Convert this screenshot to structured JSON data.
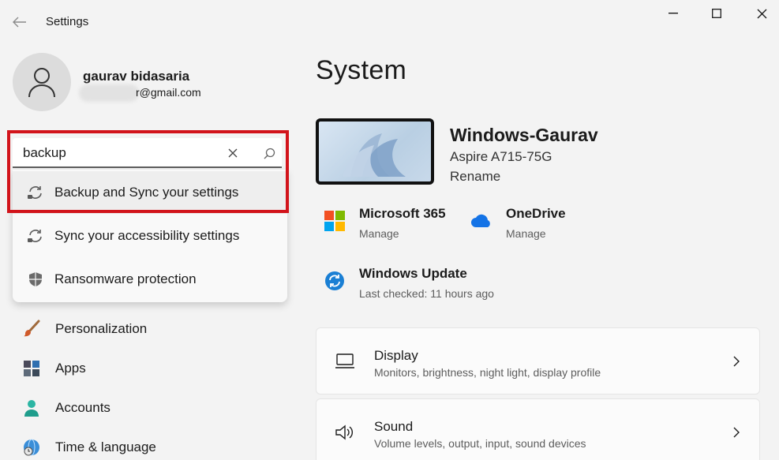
{
  "window": {
    "title": "Settings"
  },
  "profile": {
    "name": "gaurav bidasaria",
    "email_visible": "r@gmail.com"
  },
  "search": {
    "value": "backup",
    "suggestions": [
      {
        "label": "Backup and Sync your settings",
        "icon": "sync-icon",
        "selected": true
      },
      {
        "label": "Sync your accessibility settings",
        "icon": "sync-icon",
        "selected": false
      },
      {
        "label": "Ransomware protection",
        "icon": "shield-icon",
        "selected": false
      }
    ]
  },
  "nav": [
    {
      "label": "Personalization",
      "icon": "paintbrush-icon"
    },
    {
      "label": "Apps",
      "icon": "apps-icon"
    },
    {
      "label": "Accounts",
      "icon": "person-icon"
    },
    {
      "label": "Time & language",
      "icon": "globe-clock-icon"
    }
  ],
  "main": {
    "title": "System",
    "device": {
      "name": "Windows-Gaurav",
      "model": "Aspire A715-75G",
      "rename": "Rename"
    },
    "quick": [
      {
        "title": "Microsoft 365",
        "sub": "Manage",
        "icon": "microsoft-logo-icon"
      },
      {
        "title": "OneDrive",
        "sub": "Manage",
        "icon": "onedrive-cloud-icon"
      },
      {
        "title": "Windows Update",
        "sub": "Last checked: 11 hours ago",
        "icon": "update-icon"
      }
    ],
    "cards": [
      {
        "title": "Display",
        "sub": "Monitors, brightness, night light, display profile",
        "icon": "display-icon"
      },
      {
        "title": "Sound",
        "sub": "Volume levels, output, input, sound devices",
        "icon": "speaker-icon"
      }
    ]
  },
  "colors": {
    "highlight": "#d2141b",
    "accent": "#0067c0",
    "background": "#f3f3f3"
  }
}
